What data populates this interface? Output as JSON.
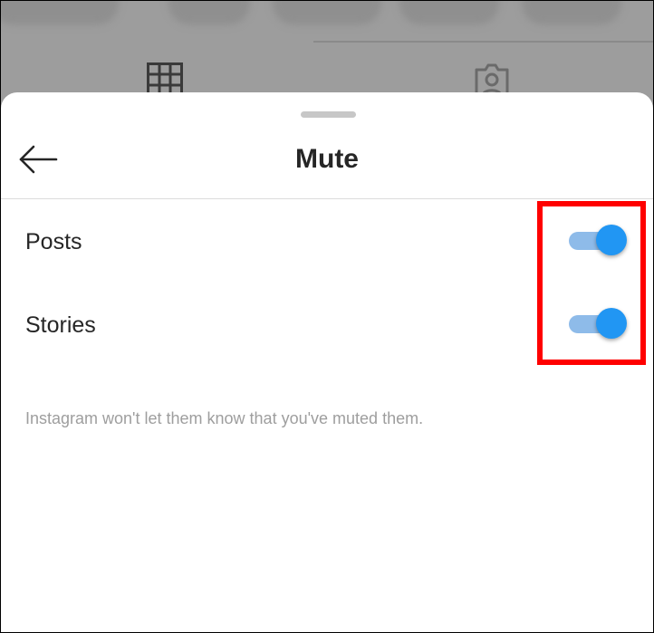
{
  "sheet": {
    "title": "Mute",
    "back_icon": "arrow-left-icon"
  },
  "options": [
    {
      "label": "Posts",
      "enabled": true
    },
    {
      "label": "Stories",
      "enabled": true
    }
  ],
  "note": "Instagram won't let them know that you've muted them.",
  "colors": {
    "toggle_thumb": "#2196f3",
    "toggle_track": "#8ebbe9",
    "highlight": "#ff0000",
    "title_text": "#262626",
    "note_text": "#9e9e9e"
  },
  "background_icons": [
    "grid-icon",
    "tagged-person-icon"
  ]
}
